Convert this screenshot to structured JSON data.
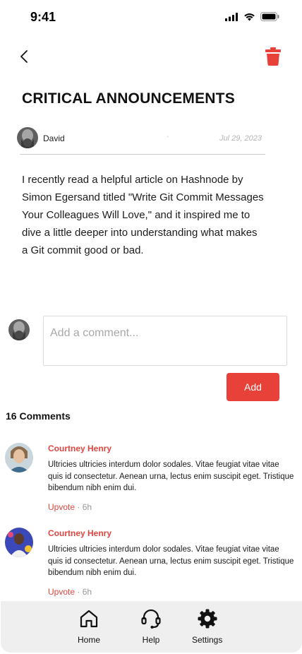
{
  "status_bar": {
    "time": "9:41"
  },
  "post": {
    "title": "CRITICAL ANNOUNCEMENTS",
    "author": "David",
    "separator": "·",
    "date": "Jul 29, 2023",
    "body": "I recently read a helpful article on Hashnode by Simon Egersand titled \"Write Git Commit Messages Your Colleagues Will Love,\" and it inspired me to dive a little deeper into understanding what makes a Git commit good or bad."
  },
  "composer": {
    "placeholder": "Add a comment...",
    "add_label": "Add"
  },
  "comments": {
    "count_label": "16 Comments",
    "items": [
      {
        "name": "Courtney Henry",
        "text": "Ultricies ultricies interdum dolor sodales. Vitae feugiat vitae vitae quis id consectetur. Aenean urna, lectus enim suscipit eget. Tristique bibendum nibh enim dui.",
        "upvote": "Upvote",
        "sep": " · ",
        "time": "6h"
      },
      {
        "name": "Courtney Henry",
        "text": "Ultricies ultricies interdum dolor sodales. Vitae feugiat vitae vitae quis id consectetur. Aenean urna, lectus enim suscipit eget. Tristique bibendum nibh enim dui.",
        "upvote": "Upvote",
        "sep": " · ",
        "time": "6h"
      }
    ]
  },
  "nav": {
    "home": "Home",
    "help": "Help",
    "settings": "Settings"
  },
  "colors": {
    "accent": "#e8413a",
    "nav_bg": "#efefef"
  },
  "icons": [
    "signal-icon",
    "wifi-icon",
    "battery-icon",
    "back-icon",
    "trash-icon",
    "home-icon",
    "headset-icon",
    "gear-icon"
  ]
}
